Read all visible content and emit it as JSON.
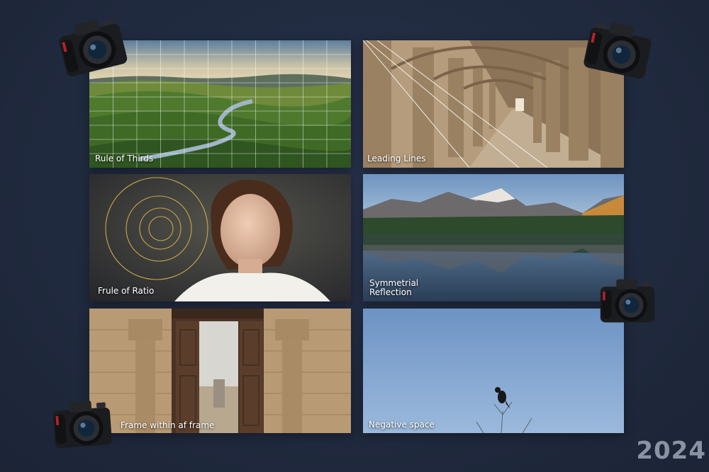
{
  "panels": {
    "rule_of_thirds": "Rule of Thirds",
    "leading_lines": "Leading Lines",
    "rule_of_ratio": "Frule of Ratio",
    "symmetrical_reflection_line1": "Symmetrial",
    "symmetrical_reflection_line2": "Reflection",
    "frame_within_frame": "Frame within af frame",
    "negative_space": "Negative space"
  },
  "year": "2024",
  "icons": [
    "camera-icon"
  ],
  "colors": {
    "background": "#222b3f",
    "spiral": "#c9a94a",
    "year": "#8a93a3"
  }
}
